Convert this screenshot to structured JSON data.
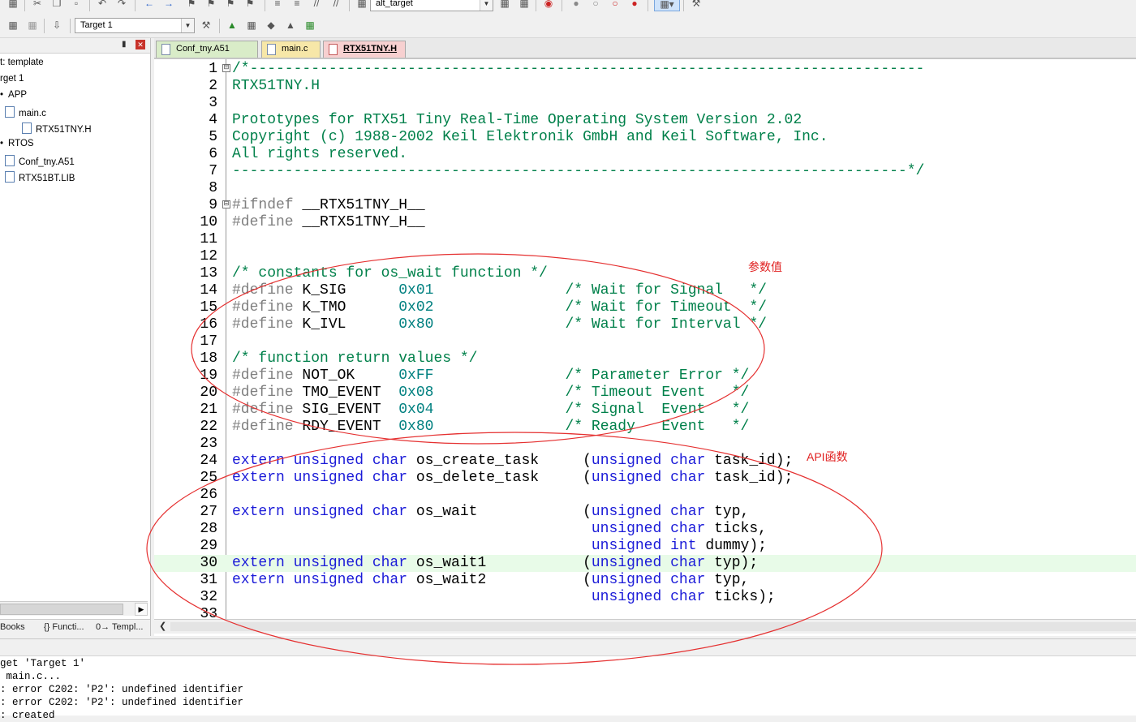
{
  "toolbar": {
    "target_combo": "alt_target",
    "build_target": "Target 1"
  },
  "project_panel": {
    "items": [
      {
        "label": "t: template"
      },
      {
        "label": "rget 1"
      },
      {
        "label": "APP"
      },
      {
        "label": "main.c"
      },
      {
        "label": "RTX51TNY.H"
      },
      {
        "label": "RTOS"
      },
      {
        "label": "Conf_tny.A51"
      },
      {
        "label": "RTX51BT.LIB"
      }
    ],
    "bottom_tabs": [
      "Books",
      "{} Functi...",
      "0→ Templ..."
    ]
  },
  "editor": {
    "tabs": [
      "Conf_tny.A51",
      "main.c",
      "RTX51TNY.H"
    ],
    "active_tab": "RTX51TNY.H",
    "highlighted_line": "30"
  },
  "code": [
    {
      "n": "1",
      "fold": "⊟",
      "segs": [
        [
          "c-com",
          "/*-----------------------------------------------------------------------------"
        ]
      ]
    },
    {
      "n": "2",
      "segs": [
        [
          "c-com",
          "RTX51TNY.H"
        ]
      ]
    },
    {
      "n": "3",
      "segs": []
    },
    {
      "n": "4",
      "segs": [
        [
          "c-com",
          "Prototypes for RTX51 Tiny Real-Time Operating System Version 2.02"
        ]
      ]
    },
    {
      "n": "5",
      "segs": [
        [
          "c-com",
          "Copyright (c) 1988-2002 Keil Elektronik GmbH and Keil Software, Inc."
        ]
      ]
    },
    {
      "n": "6",
      "segs": [
        [
          "c-com",
          "All rights reserved."
        ]
      ]
    },
    {
      "n": "7",
      "segs": [
        [
          "c-com",
          "-----------------------------------------------------------------------------*/"
        ]
      ]
    },
    {
      "n": "8",
      "segs": []
    },
    {
      "n": "9",
      "fold": "⊟",
      "segs": [
        [
          "c-pp",
          "#ifndef "
        ],
        [
          "c-plain",
          "__RTX51TNY_H__"
        ]
      ]
    },
    {
      "n": "10",
      "segs": [
        [
          "c-pp",
          "#define "
        ],
        [
          "c-plain",
          "__RTX51TNY_H__"
        ]
      ]
    },
    {
      "n": "11",
      "segs": []
    },
    {
      "n": "12",
      "segs": []
    },
    {
      "n": "13",
      "segs": [
        [
          "c-com",
          "/* constants for os_wait function */"
        ]
      ]
    },
    {
      "n": "14",
      "segs": [
        [
          "c-pp",
          "#define "
        ],
        [
          "c-plain",
          "K_SIG      "
        ],
        [
          "c-num",
          "0x01"
        ],
        [
          "c-plain",
          "               "
        ],
        [
          "c-com",
          "/* Wait for Signal   */"
        ]
      ]
    },
    {
      "n": "15",
      "segs": [
        [
          "c-pp",
          "#define "
        ],
        [
          "c-plain",
          "K_TMO      "
        ],
        [
          "c-num",
          "0x02"
        ],
        [
          "c-plain",
          "               "
        ],
        [
          "c-com",
          "/* Wait for Timeout  */"
        ]
      ]
    },
    {
      "n": "16",
      "segs": [
        [
          "c-pp",
          "#define "
        ],
        [
          "c-plain",
          "K_IVL      "
        ],
        [
          "c-num",
          "0x80"
        ],
        [
          "c-plain",
          "               "
        ],
        [
          "c-com",
          "/* Wait for Interval */"
        ]
      ]
    },
    {
      "n": "17",
      "segs": []
    },
    {
      "n": "18",
      "segs": [
        [
          "c-com",
          "/* function return values */"
        ]
      ]
    },
    {
      "n": "19",
      "segs": [
        [
          "c-pp",
          "#define "
        ],
        [
          "c-plain",
          "NOT_OK     "
        ],
        [
          "c-num",
          "0xFF"
        ],
        [
          "c-plain",
          "               "
        ],
        [
          "c-com",
          "/* Parameter Error */"
        ]
      ]
    },
    {
      "n": "20",
      "segs": [
        [
          "c-pp",
          "#define "
        ],
        [
          "c-plain",
          "TMO_EVENT  "
        ],
        [
          "c-num",
          "0x08"
        ],
        [
          "c-plain",
          "               "
        ],
        [
          "c-com",
          "/* Timeout Event   */"
        ]
      ]
    },
    {
      "n": "21",
      "segs": [
        [
          "c-pp",
          "#define "
        ],
        [
          "c-plain",
          "SIG_EVENT  "
        ],
        [
          "c-num",
          "0x04"
        ],
        [
          "c-plain",
          "               "
        ],
        [
          "c-com",
          "/* Signal  Event   */"
        ]
      ]
    },
    {
      "n": "22",
      "segs": [
        [
          "c-pp",
          "#define "
        ],
        [
          "c-plain",
          "RDY_EVENT  "
        ],
        [
          "c-num",
          "0x80"
        ],
        [
          "c-plain",
          "               "
        ],
        [
          "c-com",
          "/* Ready   Event   */"
        ]
      ]
    },
    {
      "n": "23",
      "segs": []
    },
    {
      "n": "24",
      "segs": [
        [
          "c-kw",
          "extern unsigned char "
        ],
        [
          "c-plain",
          "os_create_task     ("
        ],
        [
          "c-kw",
          "unsigned char "
        ],
        [
          "c-plain",
          "task_id);"
        ]
      ]
    },
    {
      "n": "25",
      "segs": [
        [
          "c-kw",
          "extern unsigned char "
        ],
        [
          "c-plain",
          "os_delete_task     ("
        ],
        [
          "c-kw",
          "unsigned char "
        ],
        [
          "c-plain",
          "task_id);"
        ]
      ]
    },
    {
      "n": "26",
      "segs": []
    },
    {
      "n": "27",
      "segs": [
        [
          "c-kw",
          "extern unsigned char "
        ],
        [
          "c-plain",
          "os_wait            ("
        ],
        [
          "c-kw",
          "unsigned char "
        ],
        [
          "c-plain",
          "typ,"
        ]
      ]
    },
    {
      "n": "28",
      "segs": [
        [
          "c-plain",
          "                                         "
        ],
        [
          "c-kw",
          "unsigned char "
        ],
        [
          "c-plain",
          "ticks,"
        ]
      ]
    },
    {
      "n": "29",
      "segs": [
        [
          "c-plain",
          "                                         "
        ],
        [
          "c-kw",
          "unsigned int "
        ],
        [
          "c-plain",
          "dummy);"
        ]
      ]
    },
    {
      "n": "30",
      "segs": [
        [
          "c-kw",
          "extern unsigned char "
        ],
        [
          "c-plain",
          "os_wait1           ("
        ],
        [
          "c-kw",
          "unsigned char "
        ],
        [
          "c-plain",
          "typ);"
        ]
      ]
    },
    {
      "n": "31",
      "segs": [
        [
          "c-kw",
          "extern unsigned char "
        ],
        [
          "c-plain",
          "os_wait2           ("
        ],
        [
          "c-kw",
          "unsigned char "
        ],
        [
          "c-plain",
          "typ,"
        ]
      ]
    },
    {
      "n": "32",
      "segs": [
        [
          "c-plain",
          "                                         "
        ],
        [
          "c-kw",
          "unsigned char "
        ],
        [
          "c-plain",
          "ticks);"
        ]
      ]
    },
    {
      "n": "33",
      "segs": []
    }
  ],
  "annotations": {
    "params": "参数值",
    "api": "API函数"
  },
  "output": {
    "lines": [
      "get 'Target 1'",
      " main.c...",
      ": error C202: 'P2': undefined identifier",
      ": error C202: 'P2': undefined identifier",
      ": created"
    ]
  },
  "colors": {
    "comment": "#00804a",
    "keyword": "#1b1bd8",
    "number": "#008080",
    "preprocessor": "#808080",
    "annotation": "#e02020",
    "highlight_line": "#e8fbe8"
  }
}
